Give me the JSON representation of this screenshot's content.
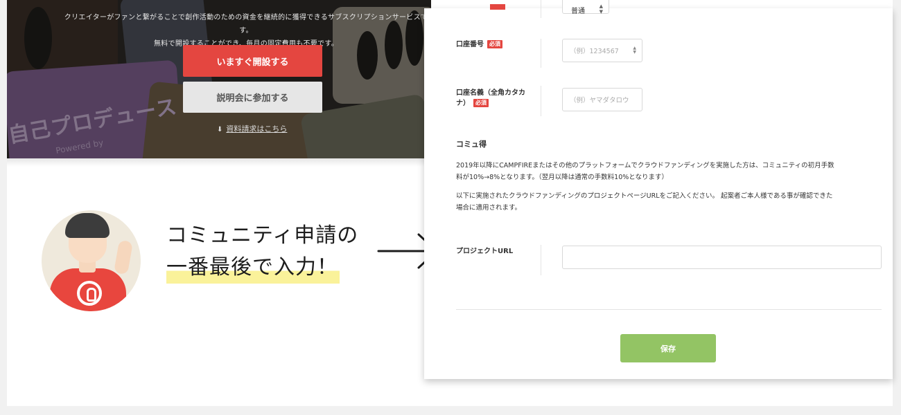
{
  "hero": {
    "tagline_line1": "クリエイターがファンと繋がることで創作活動のための資金を継続的に獲得できるサブスクリプションサービスです。",
    "tagline_line2": "無料で開設することができ、毎月の固定費用も不要です。",
    "open_button": "いますぐ開設する",
    "seminar_button": "説明会に参加する",
    "doc_link_icon": "download-icon",
    "doc_link": "資料請求はこちら",
    "produce_text": "自己プロデュース",
    "powered_text": "Powered by"
  },
  "caption": {
    "line1": "コミュニティ申請の",
    "line2": "一番最後で入力！"
  },
  "form": {
    "account_type_value": "普通",
    "account_number": {
      "label": "口座番号",
      "required_badge": "必須",
      "placeholder": "（例）1234567"
    },
    "account_name": {
      "label_line1": "口座名義（全角カタカ",
      "label_line2": "ナ）",
      "required_badge": "必須",
      "placeholder": "（例）ヤマダタロウ"
    },
    "section_title": "コミュ得",
    "paragraph1_line1": "2019年以降にCAMPFIREまたはその他のプラットフォームでクラウドファンディングを実施した方は、コミュニティの初月手数",
    "paragraph1_line2": "料が10%→8%となります。（翌月以降は通常の手数料10%となります）",
    "paragraph2_line1": "以下に実施されたクラウドファンディングのプロジェクトページURLをご記入ください。 起案者ご本人様である事が確認できた",
    "paragraph2_line2": "場合に適用されます。",
    "project_url_label": "プロジェクトURL",
    "project_url_value": "",
    "save_button": "保存"
  },
  "colors": {
    "accent_red": "#e44640",
    "save_green": "#93c464",
    "highlight_yellow": "#faf29a"
  }
}
